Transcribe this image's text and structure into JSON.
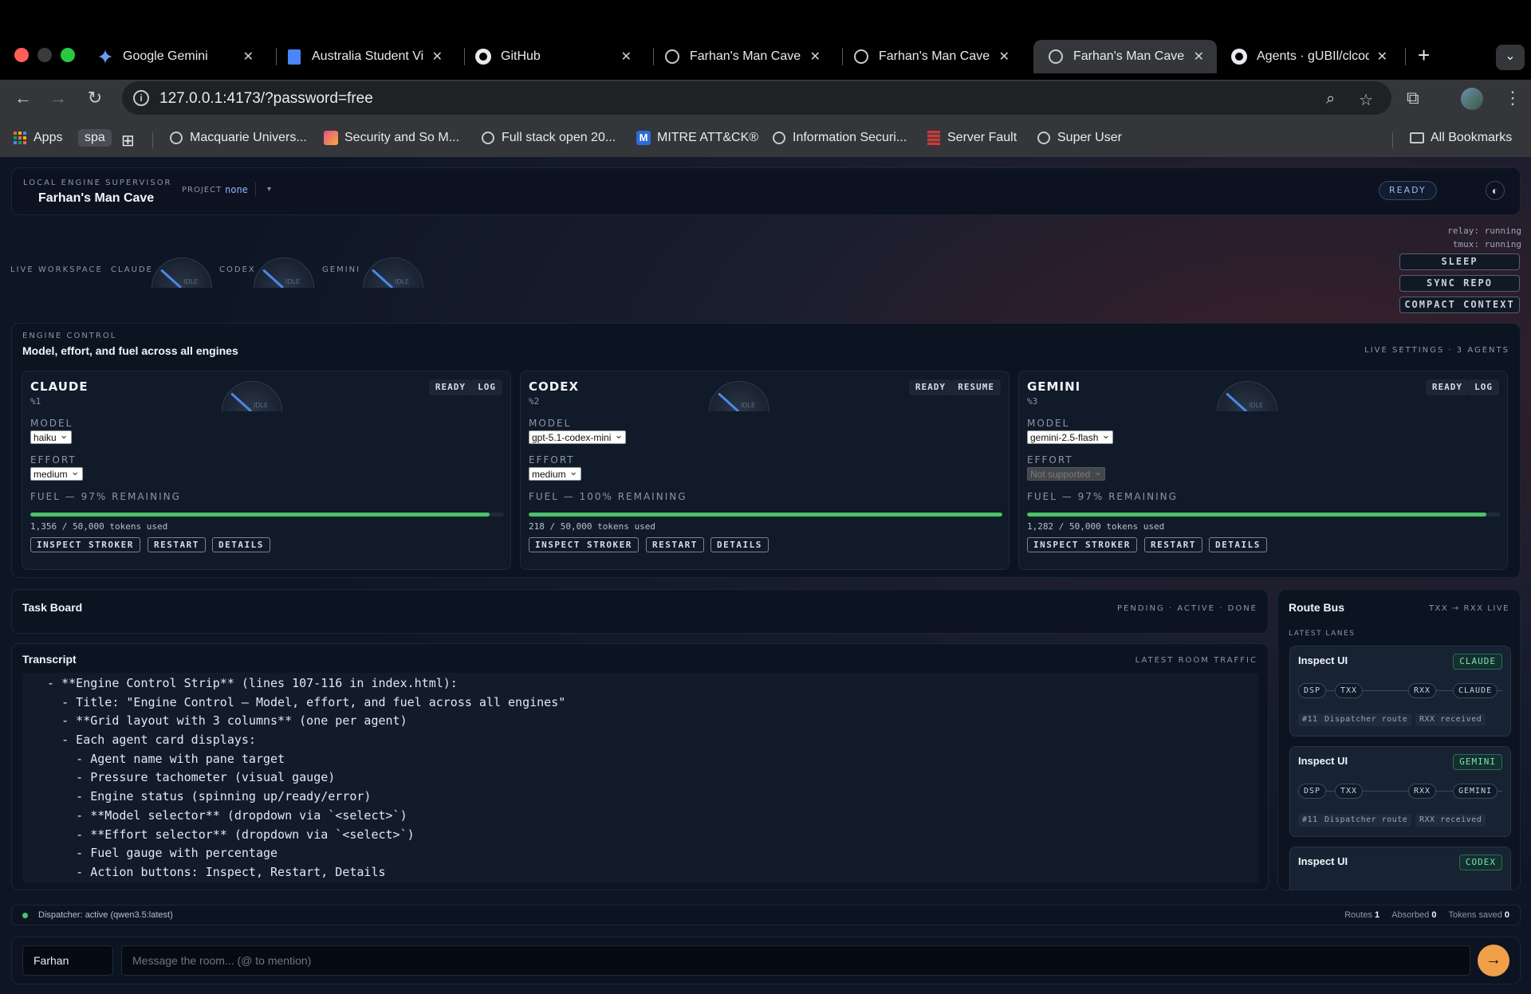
{
  "browser": {
    "tabs": [
      {
        "title": "Google Gemini",
        "icon": "gemini-icon"
      },
      {
        "title": "Australia Student Vis",
        "icon": "docs-icon"
      },
      {
        "title": "GitHub",
        "icon": "github-icon"
      },
      {
        "title": "Farhan's Man Cave",
        "icon": "globe-icon"
      },
      {
        "title": "Farhan's Man Cave",
        "icon": "globe-icon"
      },
      {
        "title": "Farhan's Man Cave",
        "icon": "globe-icon",
        "active": true
      },
      {
        "title": "Agents · gUBIl/clcod",
        "icon": "github-icon"
      }
    ],
    "new_tab": "+",
    "url": "127.0.0.1:4173/?password=free",
    "bookmarks": [
      {
        "label": "Apps",
        "icon": "apps-grid-icon"
      },
      {
        "label": "spa",
        "icon": "none"
      },
      {
        "label": "",
        "icon": "tab-groups-icon"
      },
      {
        "label": "Macquarie Univers...",
        "icon": "globe-icon"
      },
      {
        "label": "Security and So M...",
        "icon": "bookmark-favicon-icon"
      },
      {
        "label": "Full stack open 20...",
        "icon": "globe-icon"
      },
      {
        "label": "MITRE ATT&CK®",
        "icon": "mitre-icon"
      },
      {
        "label": "Information Securi...",
        "icon": "globe-icon"
      },
      {
        "label": "Server Fault",
        "icon": "server-fault-icon"
      },
      {
        "label": "Super User",
        "icon": "globe-icon"
      }
    ],
    "all_bookmarks": "All Bookmarks"
  },
  "header": {
    "eyebrow": "LOCAL ENGINE SUPERVISOR",
    "title": "Farhan's Man Cave",
    "project_label": "PROJECT",
    "project_value": "none",
    "status": "READY"
  },
  "system": {
    "relay": "relay: running",
    "tmux": "tmux: running",
    "actions": [
      "SLEEP",
      "SYNC REPO",
      "COMPACT CONTEXT"
    ]
  },
  "workspace": {
    "label": "LIVE WORKSPACE",
    "gauges": [
      "CLAUDE",
      "CODEX",
      "GEMINI"
    ],
    "gauge_text": "IDLE"
  },
  "engine_control": {
    "eyebrow": "ENGINE CONTROL",
    "title": "Model, effort, and fuel across all engines",
    "meta": "LIVE SETTINGS · 3 AGENTS",
    "model_label": "MODEL",
    "effort_label": "EFFORT",
    "cards": [
      {
        "name": "CLAUDE",
        "pane": "%1",
        "chips": [
          "READY",
          "LOG"
        ],
        "model": "haiku",
        "effort": "medium",
        "effort_disabled": false,
        "fuel_label": "FUEL — 97% REMAINING",
        "fuel_fraction": 0.97,
        "tokens": "1,356 / 50,000 tokens used",
        "actions": [
          "INSPECT STROKER",
          "RESTART",
          "DETAILS"
        ]
      },
      {
        "name": "CODEX",
        "pane": "%2",
        "chips": [
          "READY",
          "RESUME"
        ],
        "model": "gpt-5.1-codex-mini",
        "effort": "medium",
        "effort_disabled": false,
        "fuel_label": "FUEL — 100% REMAINING",
        "fuel_fraction": 1.0,
        "tokens": "218 / 50,000 tokens used",
        "actions": [
          "INSPECT STROKER",
          "RESTART",
          "DETAILS"
        ]
      },
      {
        "name": "GEMINI",
        "pane": "%3",
        "chips": [
          "READY",
          "LOG"
        ],
        "model": "gemini-2.5-flash",
        "effort": "Not supported",
        "effort_disabled": true,
        "fuel_label": "FUEL — 97% REMAINING",
        "fuel_fraction": 0.97,
        "tokens": "1,282 / 50,000 tokens used",
        "actions": [
          "INSPECT STROKER",
          "RESTART",
          "DETAILS"
        ]
      }
    ]
  },
  "task_board": {
    "title": "Task Board",
    "meta": "PENDING · ACTIVE · DONE"
  },
  "transcript": {
    "title": "Transcript",
    "meta": "LATEST ROOM TRAFFIC",
    "lines": [
      "  - **Engine Control Strip** (lines 107-116 in index.html):",
      "    - Title: \"Engine Control — Model, effort, and fuel across all engines\"",
      "    - **Grid layout with 3 columns** (one per agent)",
      "    - Each agent card displays:",
      "      - Agent name with pane target",
      "      - Pressure tachometer (visual gauge)",
      "      - Engine status (spinning up/ready/error)",
      "      - **Model selector** (dropdown via `<select>`)",
      "      - **Effort selector** (dropdown via `<select>`)",
      "      - Fuel gauge with percentage",
      "      - Action buttons: Inspect, Restart, Details"
    ]
  },
  "route_bus": {
    "title": "Route Bus",
    "meta": "TXX → RXX LIVE",
    "lanes_label": "LATEST LANES",
    "routes": [
      {
        "title": "Inspect UI",
        "target": "CLAUDE",
        "nodes": [
          "DSP",
          "TXX",
          "RXX",
          "CLAUDE"
        ],
        "meta": [
          "#11",
          "Dispatcher route",
          "RXX received"
        ]
      },
      {
        "title": "Inspect UI",
        "target": "GEMINI",
        "nodes": [
          "DSP",
          "TXX",
          "RXX",
          "GEMINI"
        ],
        "meta": [
          "#11",
          "Dispatcher route",
          "RXX received"
        ]
      },
      {
        "title": "Inspect UI",
        "target": "CODEX",
        "nodes": [],
        "meta": []
      }
    ]
  },
  "status_bar": {
    "dispatcher": "Dispatcher: active (qwen3.5:latest)",
    "routes_label": "Routes",
    "routes_value": "1",
    "absorbed_label": "Absorbed",
    "absorbed_value": "0",
    "tokens_label": "Tokens saved",
    "tokens_value": "0"
  },
  "composer": {
    "sender": "Farhan",
    "placeholder": "Message the room... (@ to mention)",
    "send_icon": "arrow-right-icon"
  },
  "colors": {
    "accent_blue": "#4a88e8",
    "fuel_green": "#4cc36a",
    "send_orange": "#f0a04a",
    "status_green": "#4cc36a"
  }
}
